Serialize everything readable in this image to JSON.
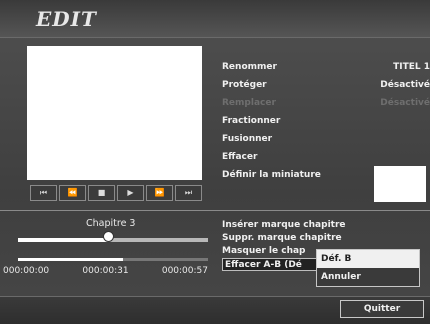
{
  "window": {
    "title": "EDIT"
  },
  "controls": {
    "buttons": [
      {
        "name": "rewind",
        "glyph": "⏮"
      },
      {
        "name": "fast-rewind",
        "glyph": "⏪"
      },
      {
        "name": "stop",
        "glyph": "■"
      },
      {
        "name": "play",
        "glyph": "▶"
      },
      {
        "name": "fast-forward",
        "glyph": "⏩"
      },
      {
        "name": "skip-forward",
        "glyph": "⏭"
      }
    ]
  },
  "menu": {
    "items": [
      {
        "label": "Renommer",
        "value": "TITEL 1",
        "disabled": false
      },
      {
        "label": "Protéger",
        "value": "Désactivé",
        "disabled": false
      },
      {
        "label": "Remplacer",
        "value": "Désactivé",
        "disabled": true
      },
      {
        "label": "Fractionner",
        "value": "",
        "disabled": false
      },
      {
        "label": "Fusionner",
        "value": "",
        "disabled": false
      },
      {
        "label": "Effacer",
        "value": "",
        "disabled": false
      },
      {
        "label": "Définir la miniature",
        "value": "",
        "disabled": false
      }
    ]
  },
  "chapter": {
    "label": "Chapitre 3",
    "position": 0.48,
    "progress": 0.55
  },
  "times": [
    "000:00:00",
    "000:00:31",
    "000:00:57"
  ],
  "lower_menu": {
    "items": [
      {
        "label": "Insérer marque chapitre"
      },
      {
        "label": "Suppr. marque chapitre"
      },
      {
        "label": "Masquer le chap"
      },
      {
        "label": "Effacer A-B (Dé"
      }
    ]
  },
  "popup": {
    "options": [
      "Déf. B",
      "Annuler"
    ]
  },
  "quit": {
    "label": "Quitter"
  }
}
